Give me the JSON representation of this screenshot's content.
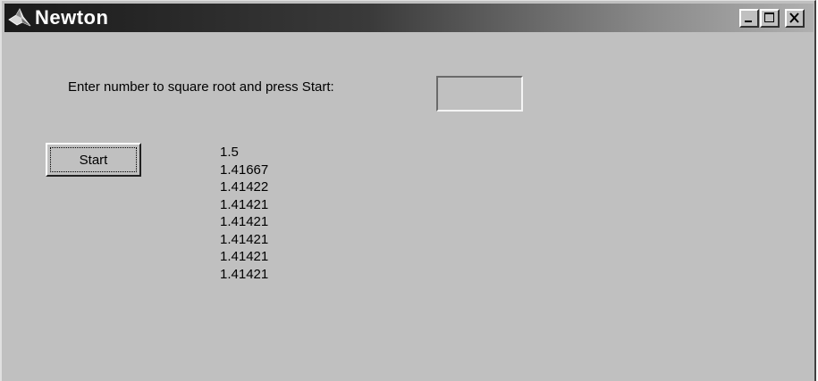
{
  "window": {
    "title": "Newton",
    "controls": {
      "minimize": "minimize",
      "maximize": "maximize",
      "close": "close"
    }
  },
  "form": {
    "prompt_label": "Enter number to square root and press Start:",
    "input_value": "",
    "start_label": "Start"
  },
  "results": [
    "1.5",
    "1.41667",
    "1.41422",
    "1.41421",
    "1.41421",
    "1.41421",
    "1.41421",
    "1.41421"
  ],
  "colors": {
    "face": "#c0c0c0",
    "titlebar_dark": "#1a1a1a",
    "titlebar_light": "#b0b0b0",
    "text": "#000000"
  }
}
